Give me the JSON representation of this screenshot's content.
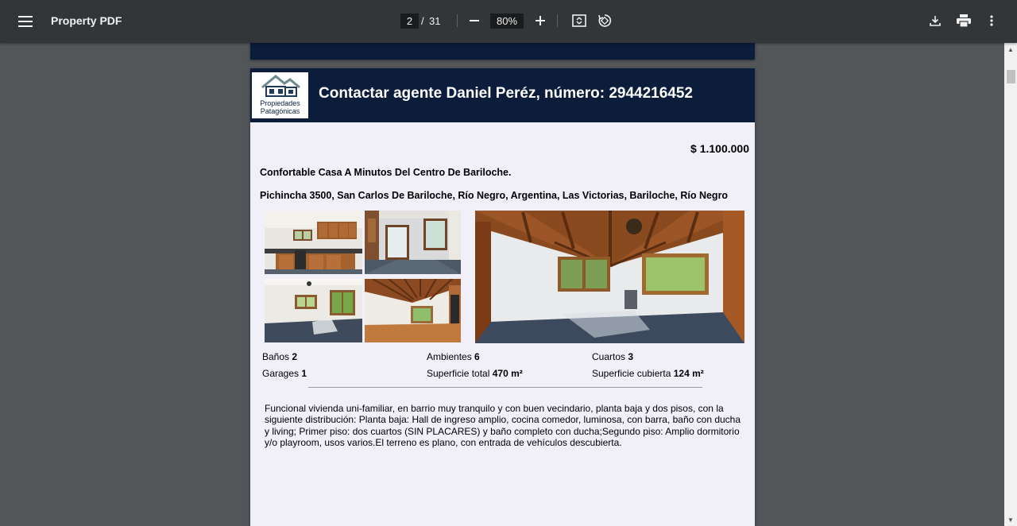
{
  "toolbar": {
    "title": "Property PDF",
    "current_page": "2",
    "page_separator": "/",
    "total_pages": "31",
    "zoom": "80%"
  },
  "icons": {
    "menu": "menu-icon",
    "zoom_out": "minus-icon",
    "zoom_in": "plus-icon",
    "fit": "fit-to-page-icon",
    "rotate": "rotate-icon",
    "download": "download-icon",
    "print": "print-icon",
    "more": "more-vert-icon"
  },
  "document": {
    "logo": {
      "line1": "Propiedades",
      "line2": "Patagónicas"
    },
    "header": "Contactar agente Daniel Peréz, número: 2944216452",
    "price": "$ 1.100.000",
    "subtitle": "Confortable Casa A Minutos Del Centro De Bariloche.",
    "address": "Pichincha 3500, San Carlos De Bariloche, Río Negro, Argentina, Las Victorias, Bariloche, Río Negro",
    "features": [
      {
        "label": "Baños",
        "value": "2"
      },
      {
        "label": "Ambientes",
        "value": "6"
      },
      {
        "label": "Cuartos",
        "value": "3"
      },
      {
        "label": "Garages",
        "value": "1"
      },
      {
        "label": "Superficie total",
        "value": "470 m²"
      },
      {
        "label": "Superficie cubierta",
        "value": "124 m²"
      }
    ],
    "description": "Funcional vivienda uni-familiar, en barrio muy tranquilo y con buen vecindario, planta baja y dos pisos, con la siguiente distribución: Planta baja: Hall de ingreso amplio, cocina comedor, luminosa, con barra, baño con ducha y living; Primer piso: dos cuartos (SIN PLACARES) y baño completo con ducha;Segundo piso: Amplio dormitorio y/o playroom, usos varios.El terreno es plano, con entrada de vehículos descubierta."
  },
  "colors": {
    "toolbar_bg": "#323639",
    "viewer_bg": "#525659",
    "header_bg": "#0b1d3a",
    "page_bg": "#f1eff8"
  }
}
